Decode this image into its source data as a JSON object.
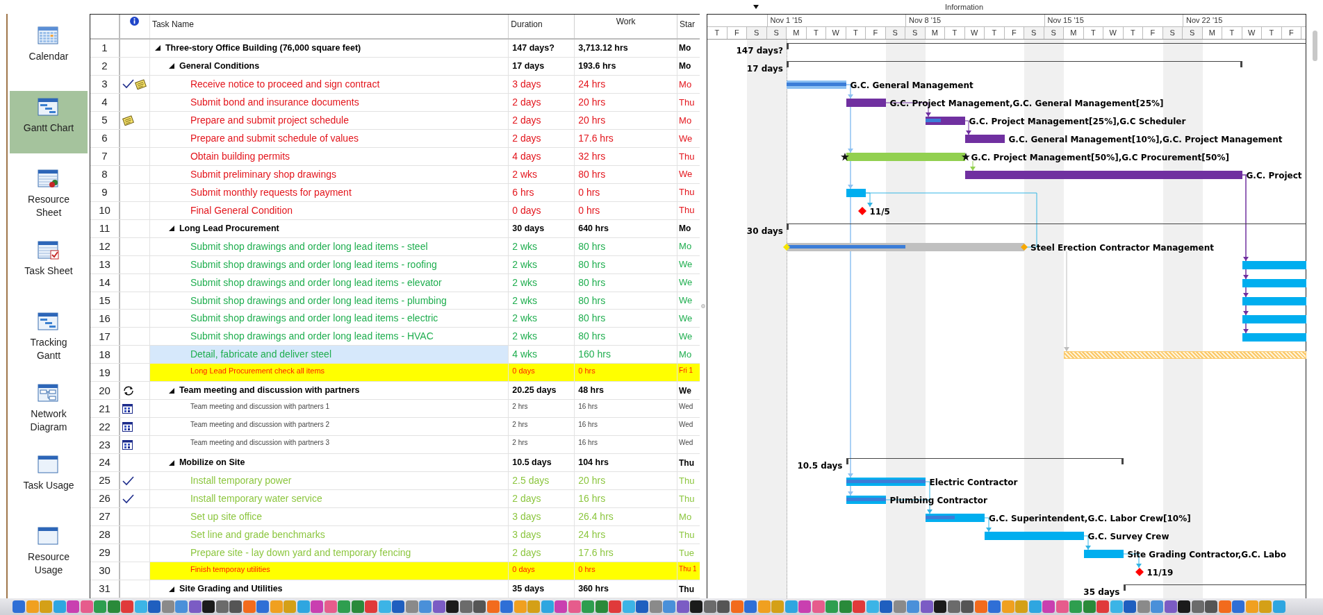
{
  "top_label": "Information",
  "sidebar": {
    "items": [
      {
        "label": "Calendar",
        "selected": false
      },
      {
        "label": "Gantt Chart",
        "selected": true
      },
      {
        "label": "Resource Sheet",
        "selected": false
      },
      {
        "label": "Task Sheet",
        "selected": false
      },
      {
        "label": "Tracking Gantt",
        "selected": false
      },
      {
        "label": "Network Diagram",
        "selected": false
      },
      {
        "label": "Task Usage",
        "selected": false
      },
      {
        "label": "Resource Usage",
        "selected": false
      }
    ]
  },
  "table": {
    "columns": [
      "Task Name",
      "Duration",
      "Work",
      "Star"
    ],
    "rows": [
      {
        "id": "1",
        "kind": "summary",
        "expanded": true,
        "selected": false,
        "name": "Three-story Office Building (76,000 square feet)",
        "duration": "147 days?",
        "work": "3,713.12 hrs",
        "start": "Mo",
        "bar": {
          "kind": "summary",
          "label": "147 days?"
        },
        "children": [
          {
            "id": "2",
            "kind": "summary",
            "expanded": true,
            "selected": false,
            "name": "General Conditions",
            "duration": "17 days",
            "work": "193.6 hrs",
            "start": "Mo",
            "bar": {
              "kind": "summary",
              "label": "17 days"
            },
            "children": [
              {
                "id": "3",
                "kind": "task",
                "color": "#e3151c",
                "selected": false,
                "indicators": [
                  {
                    "kind": "complete"
                  },
                  {
                    "kind": "note"
                  }
                ],
                "name": "Receive notice to proceed and sign contract",
                "duration": "3 days",
                "work": "24 hrs",
                "start": "Mo",
                "bar": {
                  "kind": "task",
                  "color": "#8cc0f2",
                  "level": 1,
                  "label": "G.C. General Management"
                }
              },
              {
                "id": "4",
                "kind": "task",
                "color": "#e3151c",
                "selected": false,
                "name": "Submit bond and insurance documents",
                "duration": "2 days",
                "work": "20 hrs",
                "start": "Thu",
                "bar": {
                  "kind": "task",
                  "color": "#7030a0",
                  "label": "G.C. Project Management,G.C. General Management[25%]"
                }
              },
              {
                "id": "5",
                "kind": "task",
                "color": "#e3151c",
                "selected": false,
                "indicators": [
                  {
                    "kind": "note"
                  }
                ],
                "name": "Prepare and submit project schedule",
                "duration": "2 days",
                "work": "20 hrs",
                "start": "Mo",
                "bar": {
                  "kind": "task",
                  "color": "#7030a0",
                  "level": 0.4,
                  "label": "G.C. Project Management[25%],G.C Scheduler"
                }
              },
              {
                "id": "6",
                "kind": "task",
                "color": "#e3151c",
                "selected": false,
                "name": "Prepare and submit schedule of values",
                "duration": "2 days",
                "work": "17.6 hrs",
                "start": "We",
                "bar": {
                  "kind": "task",
                  "color": "#7030a0",
                  "label": "G.C. General Management[10%],G.C. Project Management"
                }
              },
              {
                "id": "7",
                "kind": "task",
                "color": "#e3151c",
                "selected": false,
                "name": "Obtain building permits",
                "duration": "4 days",
                "work": "32 hrs",
                "start": "Thu",
                "bar": {
                  "kind": "task",
                  "color": "#92d050",
                  "pinned": true,
                  "label": "G.C. Project Management[50%],G.C Procurement[50%]"
                }
              },
              {
                "id": "8",
                "kind": "task",
                "color": "#e3151c",
                "selected": false,
                "name": "Submit preliminary shop drawings",
                "duration": "2 wks",
                "work": "80 hrs",
                "start": "We",
                "bar": {
                  "kind": "task",
                  "color": "#7030a0",
                  "label": "G.C. Project"
                }
              },
              {
                "id": "9",
                "kind": "task",
                "color": "#e3151c",
                "selected": false,
                "name": "Submit monthly requests for payment",
                "duration": "6 hrs",
                "work": "0 hrs",
                "start": "Thu",
                "bar": {
                  "kind": "task",
                  "color": "#00aeef"
                }
              },
              {
                "id": "10",
                "kind": "task",
                "color": "#e3151c",
                "selected": false,
                "name": "Final General Condition",
                "duration": "0 days",
                "work": "0 hrs",
                "start": "Thu",
                "bar": {
                  "kind": "milestone",
                  "label": "11/5"
                }
              }
            ]
          },
          {
            "id": "11",
            "kind": "summary",
            "expanded": true,
            "selected": false,
            "name": "Long Lead Procurement",
            "duration": "30 days",
            "work": "640 hrs",
            "start": "Mo",
            "bar": {
              "kind": "summary",
              "label": "30 days"
            },
            "children": [
              {
                "id": "12",
                "kind": "task",
                "color": "#1fae4f",
                "selected": false,
                "name": "Submit shop drawings and order long lead items - steel",
                "duration": "2 wks",
                "work": "80 hrs",
                "start": "Mo",
                "bar": {
                  "kind": "task",
                  "color": "#c0c0c0",
                  "level": 0.5,
                  "end_markers": true,
                  "label": "Steel Erection Contractor Management"
                }
              },
              {
                "id": "13",
                "kind": "task",
                "color": "#1fae4f",
                "selected": false,
                "name": "Submit shop drawings and order long lead items - roofing",
                "duration": "2 wks",
                "work": "80 hrs",
                "start": "We",
                "bar": {
                  "kind": "task",
                  "color": "#00aeef"
                }
              },
              {
                "id": "14",
                "kind": "task",
                "color": "#1fae4f",
                "selected": false,
                "name": "Submit shop drawings and order long lead items - elevator",
                "duration": "2 wks",
                "work": "80 hrs",
                "start": "We",
                "bar": {
                  "kind": "task",
                  "color": "#00aeef"
                }
              },
              {
                "id": "15",
                "kind": "task",
                "color": "#1fae4f",
                "selected": false,
                "name": "Submit shop drawings and order long lead items - plumbing",
                "duration": "2 wks",
                "work": "80 hrs",
                "start": "We",
                "bar": {
                  "kind": "task",
                  "color": "#00aeef"
                }
              },
              {
                "id": "16",
                "kind": "task",
                "color": "#1fae4f",
                "selected": false,
                "name": "Submit shop drawings and order long lead items - electric",
                "duration": "2 wks",
                "work": "80 hrs",
                "start": "We",
                "bar": {
                  "kind": "task",
                  "color": "#00aeef"
                }
              },
              {
                "id": "17",
                "kind": "task",
                "color": "#1fae4f",
                "selected": false,
                "name": "Submit shop drawings and order long lead items - HVAC",
                "duration": "2 wks",
                "work": "80 hrs",
                "start": "We",
                "bar": {
                  "kind": "task",
                  "color": "#00aeef"
                }
              },
              {
                "id": "18",
                "kind": "task",
                "color": "#1fae4f",
                "selected": true,
                "name": "Detail, fabricate and deliver steel",
                "duration": "4 wks",
                "work": "160 hrs",
                "start": "Mo",
                "bar": {
                  "kind": "hatched",
                  "color": "#fbc96a"
                }
              },
              {
                "id": "19",
                "kind": "flag",
                "color": "#ff1a00",
                "selected": false,
                "name": "Long Lead Procurement check all items",
                "duration": "0 days",
                "work": "0 hrs",
                "start": "Fri 1"
              }
            ]
          },
          {
            "id": "20",
            "kind": "summary",
            "expanded": true,
            "selected": false,
            "indicators": [
              {
                "kind": "recurring"
              }
            ],
            "name": "Team meeting and discussion with partners",
            "duration": "20.25 days",
            "work": "48 hrs",
            "start": "We",
            "children": [
              {
                "id": "21",
                "kind": "small",
                "selected": false,
                "indicators": [
                  {
                    "kind": "calendar"
                  }
                ],
                "name": "Team meeting and discussion with partners 1",
                "duration": "2 hrs",
                "work": "16 hrs",
                "start": "Wed"
              },
              {
                "id": "22",
                "kind": "small",
                "selected": false,
                "indicators": [
                  {
                    "kind": "calendar"
                  }
                ],
                "name": "Team meeting and discussion with partners 2",
                "duration": "2 hrs",
                "work": "16 hrs",
                "start": "Wed"
              },
              {
                "id": "23",
                "kind": "small",
                "selected": false,
                "indicators": [
                  {
                    "kind": "calendar"
                  }
                ],
                "name": "Team meeting and discussion with partners 3",
                "duration": "2 hrs",
                "work": "16 hrs",
                "start": "Wed"
              }
            ]
          },
          {
            "id": "24",
            "kind": "summary",
            "expanded": true,
            "selected": false,
            "name": "Mobilize on Site",
            "duration": "10.5 days",
            "work": "104 hrs",
            "start": "Thu",
            "bar": {
              "kind": "summary",
              "label": "10.5 days"
            },
            "children": [
              {
                "id": "25",
                "kind": "task",
                "color": "#8cc63f",
                "selected": false,
                "indicators": [
                  {
                    "kind": "complete"
                  }
                ],
                "name": "Install temporary power",
                "duration": "2.5 days",
                "work": "20 hrs",
                "start": "Thu",
                "bar": {
                  "kind": "task",
                  "color": "#00aeef",
                  "level": 1,
                  "label": "Electric Contractor"
                }
              },
              {
                "id": "26",
                "kind": "task",
                "color": "#8cc63f",
                "selected": false,
                "indicators": [
                  {
                    "kind": "complete"
                  }
                ],
                "name": "Install temporary water service",
                "duration": "2 days",
                "work": "16 hrs",
                "start": "Thu",
                "bar": {
                  "kind": "task",
                  "color": "#00aeef",
                  "level": 1,
                  "label": "Plumbing Contractor"
                }
              },
              {
                "id": "27",
                "kind": "task",
                "color": "#8cc63f",
                "selected": false,
                "name": "Set up site office",
                "duration": "3 days",
                "work": "26.4 hrs",
                "start": "Mo",
                "bar": {
                  "kind": "task",
                  "color": "#00aeef",
                  "level": 0.5,
                  "label": "G.C. Superintendent,G.C. Labor Crew[10%]"
                }
              },
              {
                "id": "28",
                "kind": "task",
                "color": "#8cc63f",
                "selected": false,
                "name": "Set line and grade benchmarks",
                "duration": "3 days",
                "work": "24 hrs",
                "start": "Thu",
                "bar": {
                  "kind": "task",
                  "color": "#00aeef",
                  "label": "G.C. Survey Crew"
                }
              },
              {
                "id": "29",
                "kind": "task",
                "color": "#8cc63f",
                "selected": false,
                "name": "Prepare site - lay down yard and temporary fencing",
                "duration": "2 days",
                "work": "17.6 hrs",
                "start": "Tue",
                "bar": {
                  "kind": "task",
                  "color": "#00aeef",
                  "label": "Site Grading Contractor,G.C. Labo"
                }
              },
              {
                "id": "30",
                "kind": "flag",
                "color": "#ff1a00",
                "selected": false,
                "name": "Finish temporay utilities",
                "duration": "0 days",
                "work": "0 hrs",
                "start": "Thu 1",
                "bar": {
                  "kind": "milestone",
                  "label": "11/19"
                }
              }
            ]
          },
          {
            "id": "31",
            "kind": "summary",
            "expanded": true,
            "selected": false,
            "name": "Site Grading and Utilities",
            "duration": "35 days",
            "work": "360 hrs",
            "start": "Thu",
            "bar": {
              "kind": "summary",
              "label": "35 days"
            }
          }
        ]
      }
    ]
  },
  "timeline": {
    "weeks": [
      "Nov 1 '15",
      "Nov 8 '15",
      "Nov 15 '15",
      "Nov 22 '15"
    ],
    "days": [
      {
        "label": "T",
        "weekend": false
      },
      {
        "label": "F",
        "weekend": false
      },
      {
        "label": "S",
        "weekend": true
      },
      {
        "label": "S",
        "weekend": true
      },
      {
        "label": "M",
        "weekend": false
      },
      {
        "label": "T",
        "weekend": false
      },
      {
        "label": "W",
        "weekend": false
      },
      {
        "label": "T",
        "weekend": false
      },
      {
        "label": "F",
        "weekend": false
      },
      {
        "label": "S",
        "weekend": true
      },
      {
        "label": "S",
        "weekend": true
      },
      {
        "label": "M",
        "weekend": false
      },
      {
        "label": "T",
        "weekend": false
      },
      {
        "label": "W",
        "weekend": false
      },
      {
        "label": "T",
        "weekend": false
      },
      {
        "label": "F",
        "weekend": false
      },
      {
        "label": "S",
        "weekend": true
      },
      {
        "label": "S",
        "weekend": true
      },
      {
        "label": "M",
        "weekend": false
      },
      {
        "label": "T",
        "weekend": false
      },
      {
        "label": "W",
        "weekend": false
      },
      {
        "label": "T",
        "weekend": false
      },
      {
        "label": "F",
        "weekend": false
      },
      {
        "label": "S",
        "weekend": true
      },
      {
        "label": "S",
        "weekend": true
      },
      {
        "label": "M",
        "weekend": false
      },
      {
        "label": "T",
        "weekend": false
      },
      {
        "label": "W",
        "weekend": false
      },
      {
        "label": "T",
        "weekend": false
      },
      {
        "label": "F",
        "weekend": false
      }
    ]
  }
}
